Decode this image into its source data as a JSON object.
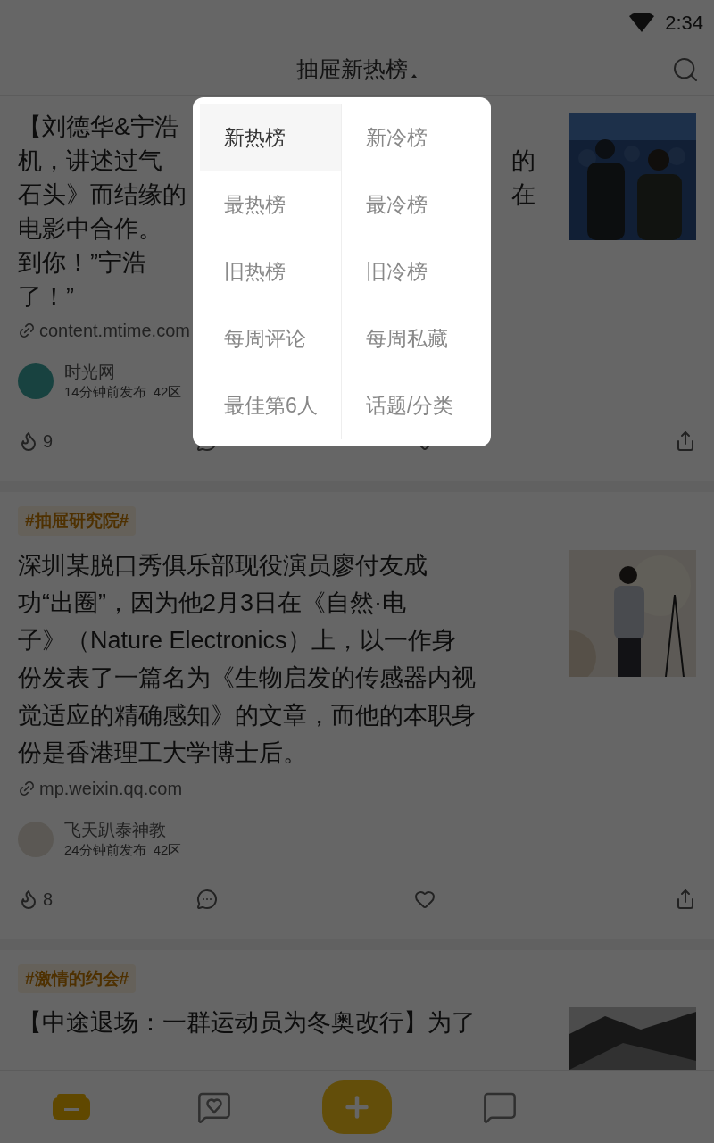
{
  "status_bar": {
    "time": "2:34"
  },
  "header": {
    "title": "抽屉新热榜",
    "menu_expanded": true
  },
  "menu": {
    "items": [
      {
        "label": "新热榜",
        "selected": true
      },
      {
        "label": "新冷榜",
        "selected": false
      },
      {
        "label": "最热榜",
        "selected": false
      },
      {
        "label": "最冷榜",
        "selected": false
      },
      {
        "label": "旧热榜",
        "selected": false
      },
      {
        "label": "旧冷榜",
        "selected": false
      },
      {
        "label": "每周评论",
        "selected": false
      },
      {
        "label": "每周私藏",
        "selected": false
      },
      {
        "label": "最佳第6人",
        "selected": false
      },
      {
        "label": "话题/分类",
        "selected": false
      }
    ]
  },
  "posts": [
    {
      "lines": [
        {
          "left": "【刘德华&宁浩"
        },
        {
          "left": "机，讲述过气",
          "right": "的"
        },
        {
          "left": "石头》而结缘的",
          "right": "在"
        },
        {
          "left": "电影中合作。"
        },
        {
          "left": "到你！”宁浩"
        },
        {
          "left": "了！”"
        }
      ],
      "link": "content.mtime.com",
      "author": "时光网",
      "time": "14分钟前发布",
      "zone": "42区",
      "likes": "9"
    },
    {
      "tag": "#抽屉研究院#",
      "lines": [
        {
          "left": "深圳某脱口秀俱乐部现役演员廖付友成"
        },
        {
          "left": "功“出圈”，因为他2月3日在《自然·电"
        },
        {
          "left": "子》（Nature Electronics）上，以一作身"
        },
        {
          "left": "份发表了一篇名为《生物启发的传感器内视"
        },
        {
          "left": "觉适应的精确感知》的文章，而他的本职身"
        },
        {
          "left": "份是香港理工大学博士后。"
        }
      ],
      "link": "mp.weixin.qq.com",
      "author": "飞天趴泰神教",
      "time": "24分钟前发布",
      "zone": "42区",
      "likes": "8"
    },
    {
      "tag": "#激情的约会#",
      "lines": [
        {
          "left": "【中途退场：一群运动员为冬奥改行】为了"
        }
      ]
    }
  ],
  "bottom_nav": {
    "items": [
      {
        "selected": true
      },
      {
        "selected": false
      },
      {
        "selected": false
      }
    ]
  }
}
